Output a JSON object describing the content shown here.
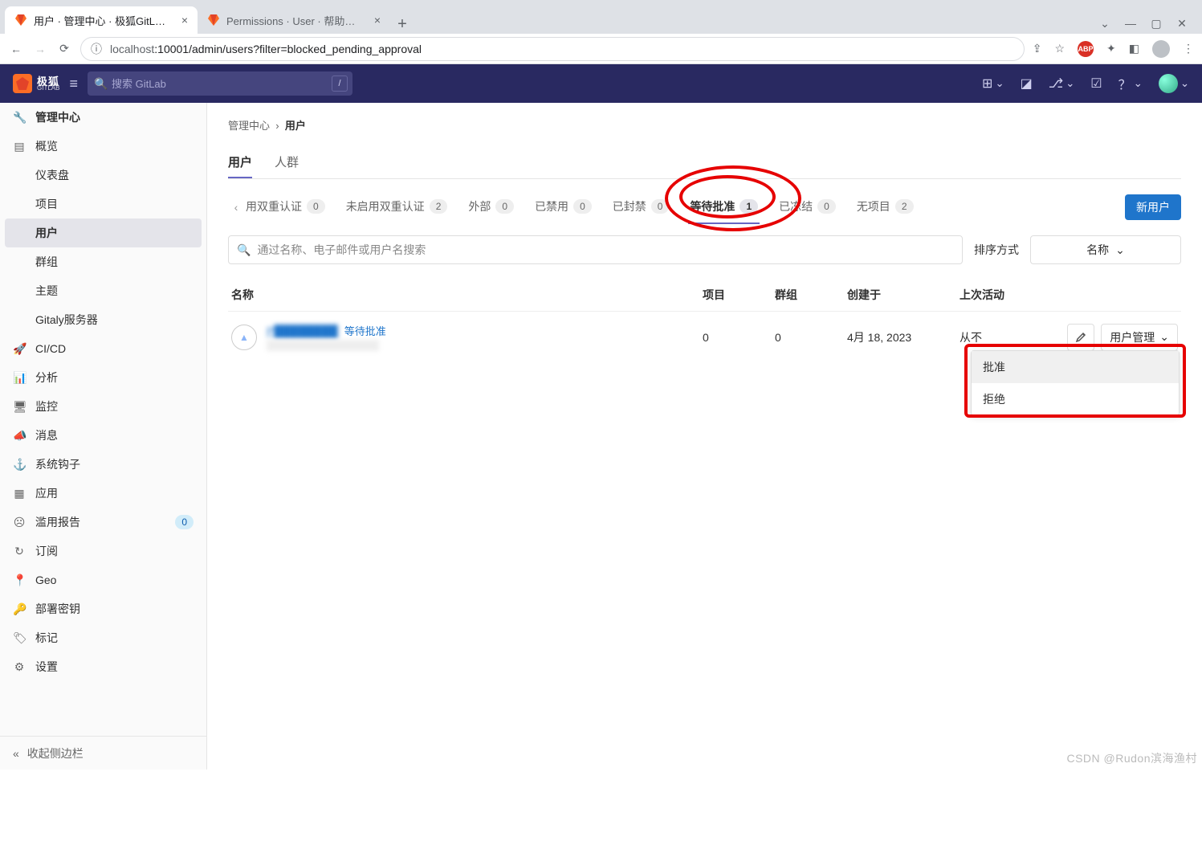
{
  "browser": {
    "tabs": [
      {
        "title": "用户 · 管理中心 · 极狐GitL…",
        "active": true
      },
      {
        "title": "Permissions · User · 帮助…",
        "active": false
      }
    ],
    "url_host": "localhost",
    "url_path": ":10001/admin/users?filter=blocked_pending_approval"
  },
  "topnav": {
    "brand_text": "极狐",
    "brand_sub": "GITLAB",
    "search_placeholder": "搜索 GitLab",
    "search_shortcut": "/"
  },
  "sidebar": {
    "header": "管理中心",
    "collapse_label": "收起侧边栏",
    "groups": [
      {
        "label": "概览",
        "items": [
          {
            "label": "仪表盘"
          },
          {
            "label": "项目"
          },
          {
            "label": "用户",
            "active": true
          },
          {
            "label": "群组"
          },
          {
            "label": "主题"
          },
          {
            "label": "Gitaly服务器"
          }
        ]
      },
      {
        "label": "CI/CD"
      },
      {
        "label": "分析"
      },
      {
        "label": "监控"
      },
      {
        "label": "消息"
      },
      {
        "label": "系统钩子"
      },
      {
        "label": "应用"
      },
      {
        "label": "滥用报告",
        "badge": "0"
      },
      {
        "label": "订阅"
      },
      {
        "label": "Geo"
      },
      {
        "label": "部署密钥"
      },
      {
        "label": "标记"
      },
      {
        "label": "设置"
      }
    ]
  },
  "breadcrumb": {
    "root": "管理中心",
    "sep": "›",
    "current": "用户"
  },
  "toptabs": {
    "users": "用户",
    "cohorts": "人群"
  },
  "filter_tabs": [
    {
      "label": "启用双重认证",
      "count": "0",
      "truncated_label": "用双重认证"
    },
    {
      "label": "未启用双重认证",
      "count": "2"
    },
    {
      "label": "外部",
      "count": "0"
    },
    {
      "label": "已禁用",
      "count": "0"
    },
    {
      "label": "已封禁",
      "count": "0"
    },
    {
      "label": "等待批准",
      "count": "1",
      "active": true
    },
    {
      "label": "已冻结",
      "count": "0"
    },
    {
      "label": "无项目",
      "count": "2"
    }
  ],
  "new_user_btn": "新用户",
  "search": {
    "placeholder": "通过名称、电子邮件或用户名搜索"
  },
  "sort": {
    "label": "排序方式",
    "value": "名称"
  },
  "table": {
    "headers": {
      "name": "名称",
      "projects": "项目",
      "groups": "群组",
      "created": "创建于",
      "activity": "上次活动"
    },
    "row": {
      "name": "P████████",
      "tag": "等待批准",
      "projects": "0",
      "groups": "0",
      "created": "4月 18, 2023",
      "activity": "从不",
      "manage_label": "用户管理"
    }
  },
  "dropdown": {
    "approve": "批准",
    "reject": "拒绝"
  },
  "watermark": "CSDN @Rudon滨海渔村"
}
